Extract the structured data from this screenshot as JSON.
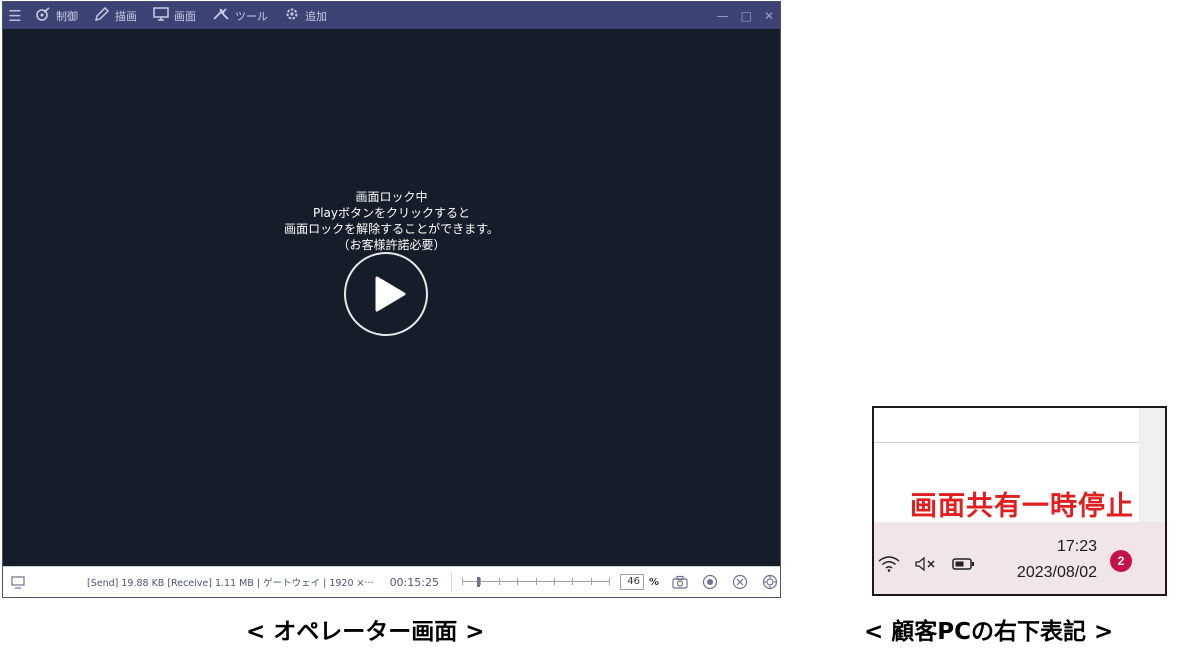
{
  "operator": {
    "menu": [
      {
        "icon": "control-icon",
        "label": "制御"
      },
      {
        "icon": "pencil-icon",
        "label": "描画"
      },
      {
        "icon": "monitor-icon",
        "label": "画面"
      },
      {
        "icon": "tools-icon",
        "label": "ツール"
      },
      {
        "icon": "gear-add-icon",
        "label": "追加"
      }
    ],
    "lock_message": [
      "画面ロック中",
      "Playボタンをクリックすると",
      "画面ロックを解除することができます。",
      "（お客様許諾必要）"
    ],
    "status": {
      "stats": "[Send] 19.88 KB  [Receive] 1.11 MB | ゲートウェイ | 1920 ×···",
      "elapsed": "00:15:25",
      "zoom_value": "46",
      "zoom_unit": "%",
      "slider_level_percent": 10
    }
  },
  "customer": {
    "banner": "画面共有一時停止",
    "time": "17:23",
    "date": "2023/08/02",
    "notification_count": "2"
  },
  "captions": {
    "operator": "< オペレーター画面 >",
    "customer": "< 顧客PCの右下表記 >"
  },
  "colors": {
    "titlebar": "#3a4374",
    "screen_bg": "#151c2a",
    "banner_red": "#e02020",
    "badge": "#c4124a",
    "taskbar": "#f2e5e8"
  }
}
